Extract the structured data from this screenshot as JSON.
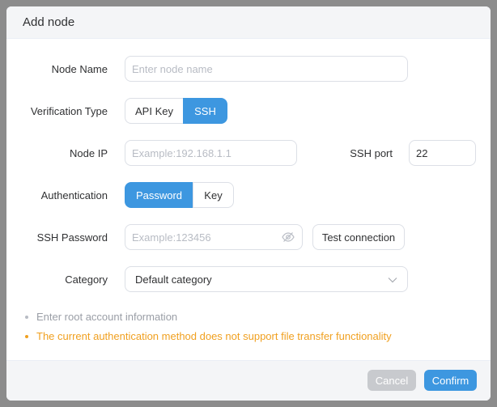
{
  "dialog": {
    "title": "Add node",
    "cancel_label": "Cancel",
    "confirm_label": "Confirm"
  },
  "form": {
    "node_name": {
      "label": "Node Name",
      "value": "",
      "placeholder": "Enter node name"
    },
    "verification_type": {
      "label": "Verification Type",
      "options": [
        "API Key",
        "SSH"
      ],
      "selected": "SSH"
    },
    "node_ip": {
      "label": "Node IP",
      "value": "",
      "placeholder": "Example:192.168.1.1"
    },
    "ssh_port": {
      "label": "SSH port",
      "value": "22",
      "placeholder": ""
    },
    "authentication": {
      "label": "Authentication",
      "options": [
        "Password",
        "Key"
      ],
      "selected": "Password"
    },
    "ssh_password": {
      "label": "SSH Password",
      "value": "",
      "placeholder": "Example:123456",
      "toggle_icon": "eye-off-icon",
      "test_label": "Test connection"
    },
    "category": {
      "label": "Category",
      "selected": "Default category",
      "icon": "chevron-down-icon"
    }
  },
  "tips": [
    {
      "text": "Enter root account information",
      "kind": "info"
    },
    {
      "text": "The current authentication method does not support file transfer functionality",
      "kind": "warning"
    }
  ],
  "colors": {
    "accent": "#3d97e0",
    "warning": "#f0a020",
    "disabled": "#c8cace",
    "overlay": "#8c8c8c"
  }
}
